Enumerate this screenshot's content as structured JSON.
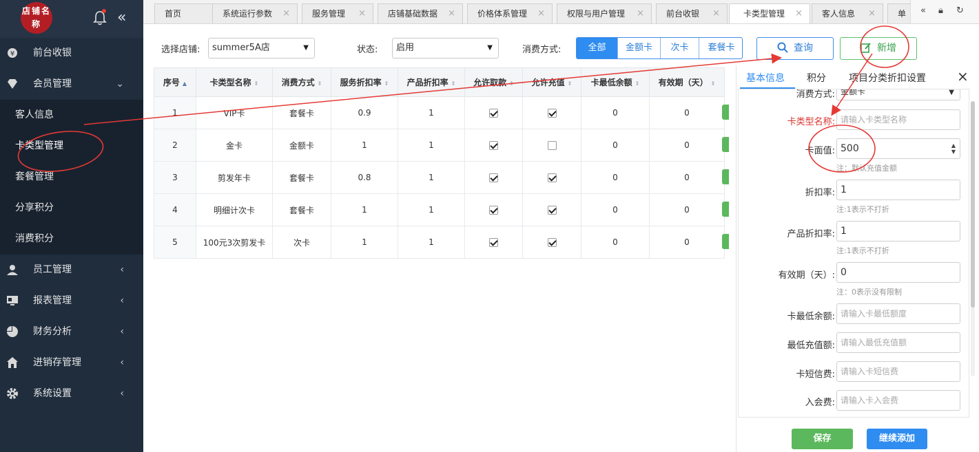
{
  "sidebar": {
    "logo_text": "店铺名称",
    "menu": [
      {
        "label": "前台收银",
        "icon": "cashier-icon"
      },
      {
        "label": "会员管理",
        "icon": "diamond-icon",
        "expanded": true
      }
    ],
    "submenu": [
      {
        "label": "客人信息"
      },
      {
        "label": "卡类型管理"
      },
      {
        "label": "套餐管理"
      },
      {
        "label": "分享积分"
      },
      {
        "label": "消费积分"
      }
    ],
    "menu2": [
      {
        "label": "员工管理",
        "icon": "user-icon"
      },
      {
        "label": "报表管理",
        "icon": "monitor-icon"
      },
      {
        "label": "财务分析",
        "icon": "pie-chart-icon"
      },
      {
        "label": "进销存管理",
        "icon": "home-icon"
      },
      {
        "label": "系统设置",
        "icon": "gear-icon"
      }
    ]
  },
  "tabs": [
    {
      "label": "首页"
    },
    {
      "label": "系统运行参数"
    },
    {
      "label": "服务管理"
    },
    {
      "label": "店铺基础数据"
    },
    {
      "label": "价格体系管理"
    },
    {
      "label": "权限与用户管理"
    },
    {
      "label": "前台收银"
    },
    {
      "label": "卡类型管理",
      "active": true
    },
    {
      "label": "客人信息"
    },
    {
      "label": "单"
    }
  ],
  "filters": {
    "store_label": "选择店铺:",
    "store_value": "summer5A店",
    "status_label": "状态:",
    "status_value": "启用",
    "mode_label": "消费方式:",
    "modes": [
      "全部",
      "金额卡",
      "次卡",
      "套餐卡"
    ],
    "query_label": "查询",
    "add_label": "新增"
  },
  "table": {
    "headers": [
      "序号",
      "卡类型名称",
      "消费方式",
      "服务折扣率",
      "产品折扣率",
      "允许取款",
      "允许充值",
      "卡最低余额",
      "有效期（天）"
    ],
    "rows": [
      {
        "idx": "1",
        "name": "VIP卡",
        "mode": "套餐卡",
        "svc": "0.9",
        "prod": "1",
        "withdraw": true,
        "recharge": true,
        "minbal": "0",
        "valid": "0"
      },
      {
        "idx": "2",
        "name": "金卡",
        "mode": "金额卡",
        "svc": "1",
        "prod": "1",
        "withdraw": true,
        "recharge": false,
        "minbal": "0",
        "valid": "0"
      },
      {
        "idx": "3",
        "name": "剪发年卡",
        "mode": "套餐卡",
        "svc": "0.8",
        "prod": "1",
        "withdraw": true,
        "recharge": true,
        "minbal": "0",
        "valid": "0"
      },
      {
        "idx": "4",
        "name": "明细计次卡",
        "mode": "套餐卡",
        "svc": "1",
        "prod": "1",
        "withdraw": true,
        "recharge": true,
        "minbal": "0",
        "valid": "0"
      },
      {
        "idx": "5",
        "name": "100元3次剪发卡",
        "mode": "次卡",
        "svc": "1",
        "prod": "1",
        "withdraw": true,
        "recharge": true,
        "minbal": "0",
        "valid": "0"
      }
    ]
  },
  "panel": {
    "tabs": [
      "基本信息",
      "积分",
      "项目分类折扣设置"
    ],
    "close": "×",
    "mode_label": "消费方式:",
    "mode_value": "金额卡",
    "name_label": "卡类型名称:",
    "name_placeholder": "请输入卡类型名称",
    "face_label": "卡面值:",
    "face_value": "500",
    "face_note": "注：默认充值金额",
    "discount_label": "折扣率:",
    "discount_value": "1",
    "discount_note": "注:1表示不打折",
    "prod_discount_label": "产品折扣率:",
    "prod_discount_value": "1",
    "prod_discount_note": "注:1表示不打折",
    "valid_label": "有效期（天）:",
    "valid_value": "0",
    "valid_note": "注：0表示没有限制",
    "minbal_label": "卡最低余额:",
    "minbal_placeholder": "请输入卡最低额度",
    "minrecharge_label": "最低充值额:",
    "minrecharge_placeholder": "请输入最低充值额",
    "sms_label": "卡短信费:",
    "sms_placeholder": "请输入卡短信费",
    "join_label": "入会费:",
    "join_placeholder": "请输入卡入会费",
    "save_label": "保存",
    "continue_label": "继续添加"
  },
  "colors": {
    "accent": "#2f8cf0",
    "success": "#5cb85c",
    "annotation": "#e53935",
    "sidebar": "#1f2d3d"
  }
}
